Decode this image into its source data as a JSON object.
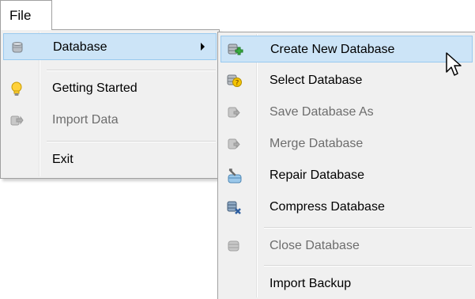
{
  "menubar": {
    "file_label": "File"
  },
  "file_menu": {
    "items": [
      {
        "label": "Database",
        "icon": "database-icon",
        "has_submenu": true,
        "highlighted": true,
        "enabled": true
      },
      {
        "label": "Getting Started",
        "icon": "lightbulb-icon",
        "enabled": true
      },
      {
        "label": "Import Data",
        "icon": "import-data-icon",
        "enabled": false
      },
      {
        "label": "Exit",
        "icon": "",
        "enabled": true
      }
    ]
  },
  "database_menu": {
    "items": [
      {
        "label": "Create New Database",
        "icon": "create-database-icon",
        "highlighted": true,
        "enabled": true
      },
      {
        "label": "Select Database",
        "icon": "select-database-icon",
        "enabled": true
      },
      {
        "label": "Save Database As",
        "icon": "save-database-icon",
        "enabled": false
      },
      {
        "label": "Merge Database",
        "icon": "merge-database-icon",
        "enabled": false
      },
      {
        "label": "Repair Database",
        "icon": "repair-database-icon",
        "enabled": true
      },
      {
        "label": "Compress Database",
        "icon": "compress-database-icon",
        "enabled": true
      },
      {
        "label": "Close Database",
        "icon": "close-database-icon",
        "enabled": false
      },
      {
        "label": "Import Backup",
        "icon": "",
        "enabled": true
      }
    ]
  },
  "colors": {
    "menu_background": "#f0f0f0",
    "highlight_background": "#cce4f7",
    "highlight_border": "#99c9ef",
    "disabled_text": "#6d6d6d"
  }
}
